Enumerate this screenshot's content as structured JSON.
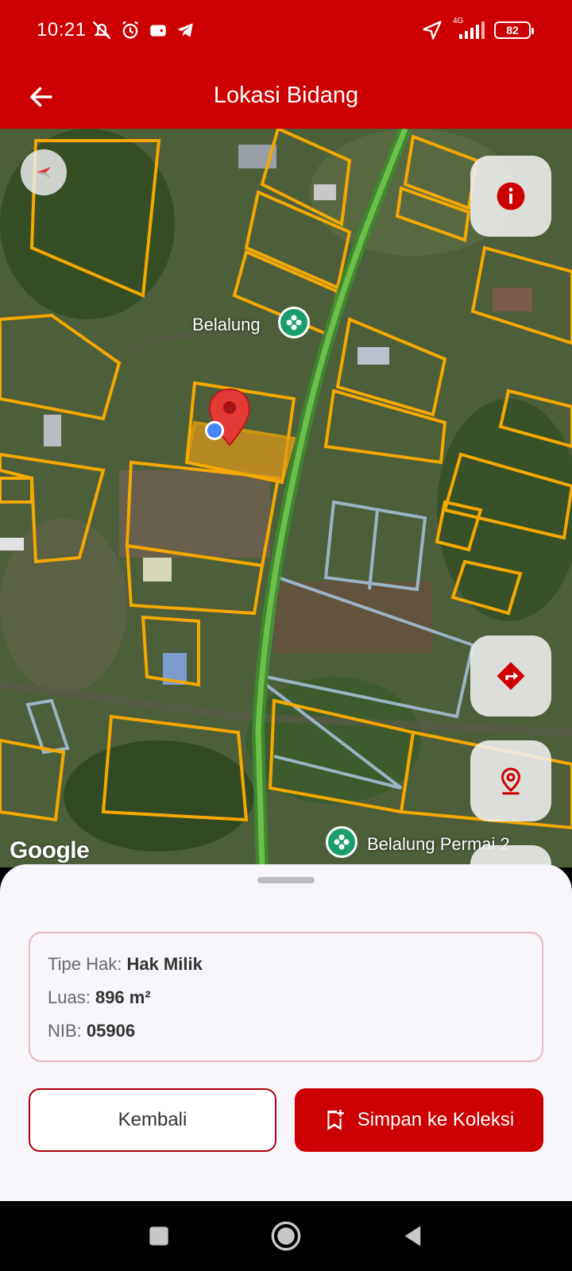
{
  "status_bar": {
    "time": "10:21",
    "network": "4G",
    "battery": "82"
  },
  "app_bar": {
    "title": "Lokasi Bidang"
  },
  "map": {
    "labels": {
      "poi_1": "Belalung",
      "poi_2": "Belalung Permai 2"
    },
    "attribution": "Google"
  },
  "parcel": {
    "rights_type_label": "Tipe Hak:",
    "rights_type_value": "Hak Milik",
    "area_label": "Luas:",
    "area_value": "896 m²",
    "nib_label": "NIB:",
    "nib_value": "05906"
  },
  "actions": {
    "back_label": "Kembali",
    "save_label": "Simpan ke Koleksi"
  },
  "colors": {
    "primary": "#cc0000",
    "parcel_outline": "#f5a800",
    "road": "#4caf50",
    "location_dot": "#4285f4"
  },
  "icons": {
    "back": "arrow-left-icon",
    "compass": "compass-icon",
    "info": "info-icon",
    "directions": "directions-icon",
    "my_location": "location-pin-icon",
    "save": "bookmark-add-icon"
  }
}
